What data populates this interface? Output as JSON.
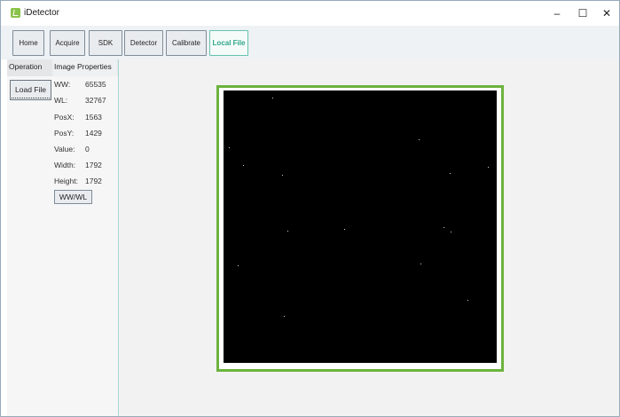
{
  "app": {
    "title": "iDetector"
  },
  "window_controls": {
    "minimize": "–",
    "maximize": "☐",
    "close": "✕"
  },
  "toolbar": {
    "buttons": [
      "Home",
      "Acquire",
      "SDK",
      "Detector",
      "Calibrate",
      "Local File"
    ],
    "active": "Local File"
  },
  "left_panel": {
    "tabs": {
      "operation": "Operation",
      "image_properties": "Image Properties"
    },
    "load_button": "Load File",
    "properties": [
      {
        "label": "WW:",
        "value": "65535"
      },
      {
        "label": "WL:",
        "value": "32767"
      },
      {
        "label": "PosX:",
        "value": "1563"
      },
      {
        "label": "PosY:",
        "value": "1429"
      },
      {
        "label": "Value:",
        "value": "0"
      },
      {
        "label": "Width:",
        "value": "1792"
      },
      {
        "label": "Height:",
        "value": "1792"
      }
    ],
    "wwwl_button": "WW/WL"
  },
  "colors": {
    "accent": "#2fa58a",
    "image_border": "#6cb33e",
    "image_background": "#000000"
  }
}
